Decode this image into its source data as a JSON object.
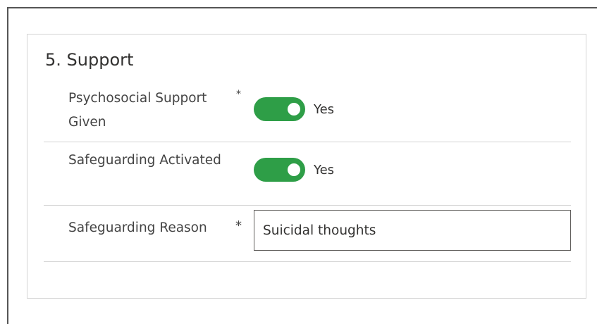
{
  "section": {
    "title": "5. Support"
  },
  "fields": [
    {
      "label": "Psychosocial Support Given",
      "required": "*",
      "type": "toggle",
      "value": "Yes",
      "on": true
    },
    {
      "label": "Safeguarding Activated",
      "type": "toggle",
      "value": "Yes",
      "on": true
    },
    {
      "label": "Safeguarding Reason",
      "required": "*",
      "type": "text",
      "value": "Suicidal thoughts"
    }
  ],
  "colors": {
    "toggle_on": "#2e9e47",
    "border": "#d4d4d4",
    "text": "#323130"
  }
}
